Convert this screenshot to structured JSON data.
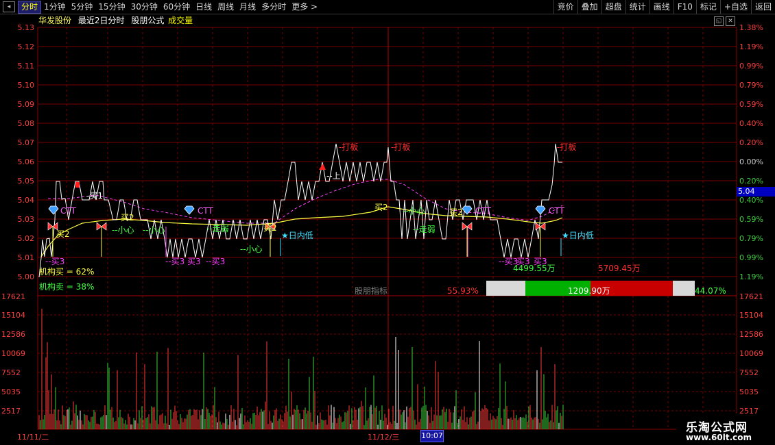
{
  "toolbar": {
    "left_items": [
      "分时",
      "1分钟",
      "5分钟",
      "15分钟",
      "30分钟",
      "60分钟",
      "日线",
      "周线",
      "月线",
      "多分时",
      "更多 >"
    ],
    "active_index": 0,
    "right_items": [
      "竞价",
      "叠加",
      "超盘",
      "统计",
      "画线",
      "F10",
      "标记",
      "+自选",
      "返回"
    ]
  },
  "info": {
    "stock_name": "华发股份",
    "period_label": "最近2日分时",
    "formula_label": "股朋公式",
    "volume_label": "成交量"
  },
  "price_axis": {
    "left": [
      "5.13",
      "5.12",
      "5.11",
      "5.10",
      "5.09",
      "5.08",
      "5.07",
      "5.06",
      "5.05",
      "5.04",
      "5.03",
      "5.02",
      "5.01",
      "5.00"
    ],
    "right": [
      "1.38%",
      "1.19%",
      "0.99%",
      "0.79%",
      "0.59%",
      "0.40%",
      "0.20%",
      "0.00%",
      "0.20%",
      "0.40%",
      "0.59%",
      "0.79%",
      "0.99%",
      "1.19%"
    ],
    "current_price": "5.04"
  },
  "volume_axis": [
    "17621",
    "15104",
    "12586",
    "10069",
    "7552",
    "5035",
    "2517"
  ],
  "dates": [
    "11/11/二",
    "11/12/三"
  ],
  "cursor_time": "10:07",
  "annotations": {
    "buy1": "-买1",
    "buy2_a": "买2",
    "buy2_b": "买2",
    "buy2_c": "买2",
    "buy2_d": "买2",
    "buy2_e": "买2",
    "buy3_a": "--买3",
    "buy3_b": "--买3",
    "buy3_c": "买3",
    "buy3_d": "--买3",
    "buy3_e": "--买3",
    "buy3_f": "买3",
    "buy3_g": "买3",
    "careful_a": "--小心",
    "careful_b": "--小心",
    "careful_c": "--小心",
    "careful_d": "--小心",
    "weak_a": "--走弱",
    "weak_b": "--走弱",
    "up": "--上",
    "ctt_a": "CTT",
    "ctt_b": "CTT",
    "ctt_c": "CTT",
    "ctt_d": "CTT",
    "limit_a": "-打板",
    "limit_b": "-打板",
    "limit_c": "-打板",
    "intraday_low_a": "★日内低",
    "intraday_low_b": "★日内低",
    "inst_buy": "机构买 = 62%",
    "inst_sell": "机构卖 = 38%",
    "indicator_label": "股朋指标",
    "left_pct": "55.93%",
    "right_pct": "44.07%",
    "amount_mid": "1209.90万",
    "amount_left": "4499.55万",
    "amount_right": "5709.45万"
  },
  "colors": {
    "up": "#ff3b3b",
    "down": "#3cd23c",
    "price_line": "#ffffff",
    "avg_line": "#ffff40",
    "ma_line": "#ff40ff",
    "grid": "#7a0000",
    "axis_text": "#ff4040"
  }
}
